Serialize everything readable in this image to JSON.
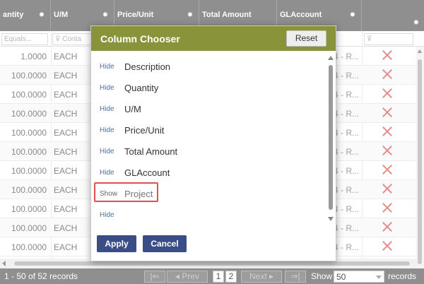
{
  "grid": {
    "headers": {
      "quantity": "antity",
      "um": "U/M",
      "price_unit": "Price/Unit",
      "total_amount": "Total Amount",
      "gl_account": "GLAccount"
    },
    "filters": {
      "quantity_placeholder": "Equals...",
      "um_placeholder": "Conta"
    },
    "rows": [
      {
        "qty": "1.0000",
        "um": "EACH",
        "gl": "4 - R..."
      },
      {
        "qty": "100.0000",
        "um": "EACH",
        "gl": "4 - R..."
      },
      {
        "qty": "100.0000",
        "um": "EACH",
        "gl": "4 - R..."
      },
      {
        "qty": "100.0000",
        "um": "EACH",
        "gl": "4 - R..."
      },
      {
        "qty": "100.0000",
        "um": "EACH",
        "gl": "4 - R..."
      },
      {
        "qty": "100.0000",
        "um": "EACH",
        "gl": "4 - R..."
      },
      {
        "qty": "100.0000",
        "um": "EACH",
        "gl": "4 - R..."
      },
      {
        "qty": "100.0000",
        "um": "EACH",
        "gl": "4 - R..."
      },
      {
        "qty": "100.0000",
        "um": "EACH",
        "gl": "4 - R..."
      },
      {
        "qty": "100.0000",
        "um": "EACH",
        "gl": "4 - R..."
      },
      {
        "qty": "100.0000",
        "um": "EACH",
        "gl": "4 - R..."
      }
    ]
  },
  "pager": {
    "record_count": "1 - 50 of 52 records",
    "first": "|⇐",
    "prev": "◂ Prev",
    "page1": "1",
    "page2": "2",
    "next": "Next ▸",
    "last": "⇒|",
    "show_label": "Show",
    "page_size": "50",
    "records_label": "records"
  },
  "column_chooser": {
    "title": "Column Chooser",
    "reset_label": "Reset",
    "columns": [
      {
        "action": "Hide",
        "name": "Description"
      },
      {
        "action": "Hide",
        "name": "Quantity"
      },
      {
        "action": "Hide",
        "name": "U/M"
      },
      {
        "action": "Hide",
        "name": "Price/Unit"
      },
      {
        "action": "Hide",
        "name": "Total Amount"
      },
      {
        "action": "Hide",
        "name": "GLAccount"
      },
      {
        "action": "Show",
        "name": "Project"
      },
      {
        "action": "Hide",
        "name": ""
      }
    ],
    "apply_label": "Apply",
    "cancel_label": "Cancel"
  },
  "colors": {
    "modal_header": "#899339",
    "primary_button": "#3b4d87",
    "highlight_border": "#d9534f",
    "grid_header": "#8f8f8f",
    "delete_icon": "#e48b8b"
  }
}
